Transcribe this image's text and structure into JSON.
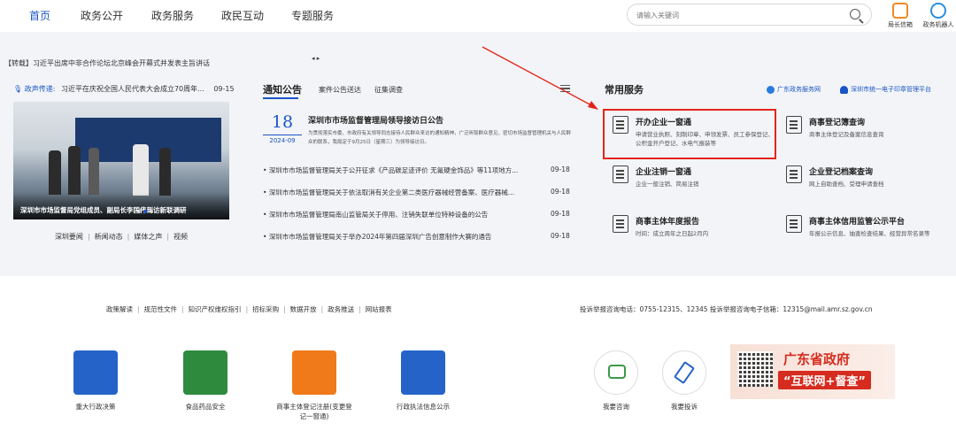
{
  "nav": {
    "items": [
      {
        "label": "首页"
      },
      {
        "label": "政务公开"
      },
      {
        "label": "政务服务"
      },
      {
        "label": "政民互动"
      },
      {
        "label": "专题服务"
      }
    ],
    "search_placeholder": "请输入关键词",
    "tools": [
      {
        "label": "局长信箱",
        "icon": "mailbox-icon",
        "color": "#f08a24"
      },
      {
        "label": "政务机器人",
        "icon": "robot-icon",
        "color": "#2a8fe0"
      }
    ]
  },
  "ticker": {
    "text": "【转载】习近平出席中非合作论坛北京峰会开幕式并发表主旨讲话",
    "arrows": "◂ ▸"
  },
  "voice": {
    "label": "政声传递:",
    "text": "习近平在庆祝全国人民代表大会成立70周年...",
    "date": "09-15"
  },
  "photo": {
    "caption": "深圳市市场监督局党组成员、副局长李国伟到访新联调研"
  },
  "left_links": [
    "深圳要闻",
    "新闻动态",
    "媒体之声",
    "视频"
  ],
  "notice": {
    "title": "通知公告",
    "tabs": [
      "案件公告送达",
      "征集调查"
    ],
    "featured": {
      "day": "18",
      "year_month": "2024-09",
      "title": "深圳市市场监督管理局领导接访日公告",
      "desc": "为贯彻落实市委、市政府有关领导同志接待人民群众来访的通知精神，广泛听取群众意见，密切市场监督管理机关与人民群众的联系，我局定于9月25日（星期三）为领导接访日。"
    },
    "items": [
      {
        "title": "深圳市市场监督管理局关于公开征求《产品碳足迹评价 无氟硬金饰品》等11项地方...",
        "date": "09-18"
      },
      {
        "title": "深圳市市场监督管理局关于依法取消有关企业第二类医疗器械经营备案、医疗器械...",
        "date": "09-18"
      },
      {
        "title": "深圳市市场监督管理局南山监管局关于停用、注销失联单位特种设备的公告",
        "date": "09-18"
      },
      {
        "title": "深圳市市场监督管理局关于举办2024年第四届深圳广告创意制作大赛的通告",
        "date": "09-18"
      }
    ]
  },
  "services": {
    "title": "常用服务",
    "links": [
      {
        "label": "广东政务服务网",
        "color": "#1a55c6"
      },
      {
        "label": "深圳市统一电子印章管理平台",
        "color": "#1a55c6"
      }
    ],
    "items": [
      {
        "name": "开办企业一窗通",
        "desc": "申请营业执照、刻制印章、申领发票、员工参保登记、公积金开户登记、水电气报装等"
      },
      {
        "name": "商事登记簿查询",
        "desc": "商事主体登记及备案信息查询"
      },
      {
        "name": "企业注销一窗通",
        "desc": "企业一般注销、简易注销"
      },
      {
        "name": "企业登记档案查询",
        "desc": "网上自助查档、受理申请查档"
      },
      {
        "name": "商事主体年度报告",
        "desc": "时间：成立周年之日起2月内"
      },
      {
        "name": "商事主体信用监管公示平台",
        "desc": "年报公示信息、抽查检查结果、经营异常名录等"
      }
    ],
    "highlight_color": "#e3241b"
  },
  "footer": {
    "links": [
      "政策解读",
      "规范性文件",
      "知识产权维权指引",
      "招标采购",
      "数据开放",
      "政务推送",
      "网站报表"
    ],
    "contact": "投诉举报咨询电话：0755-12315、12345    投诉举报咨询电子信箱：12315@mail.amr.sz.gov.cn",
    "apps": [
      {
        "label": "重大行政决策",
        "icon": "decision-icon",
        "color": "#2563c9"
      },
      {
        "label": "食品药品安全",
        "icon": "fda-icon",
        "color": "#2e8b3e"
      },
      {
        "label": "商事主体登记注册(变更登记一窗通)",
        "icon": "registration-icon",
        "color": "#f07a1a"
      },
      {
        "label": "行政执法信息公示",
        "icon": "enforcement-icon",
        "color": "#2563c9"
      }
    ],
    "circles": [
      {
        "label": "我要咨询",
        "icon": "consult-icon",
        "color": "#3a9a4a"
      },
      {
        "label": "我要投诉",
        "icon": "complaint-icon",
        "color": "#2563c9"
      }
    ],
    "banner": {
      "line1": "广东省政府",
      "line2": "“互联网+督查”"
    }
  }
}
